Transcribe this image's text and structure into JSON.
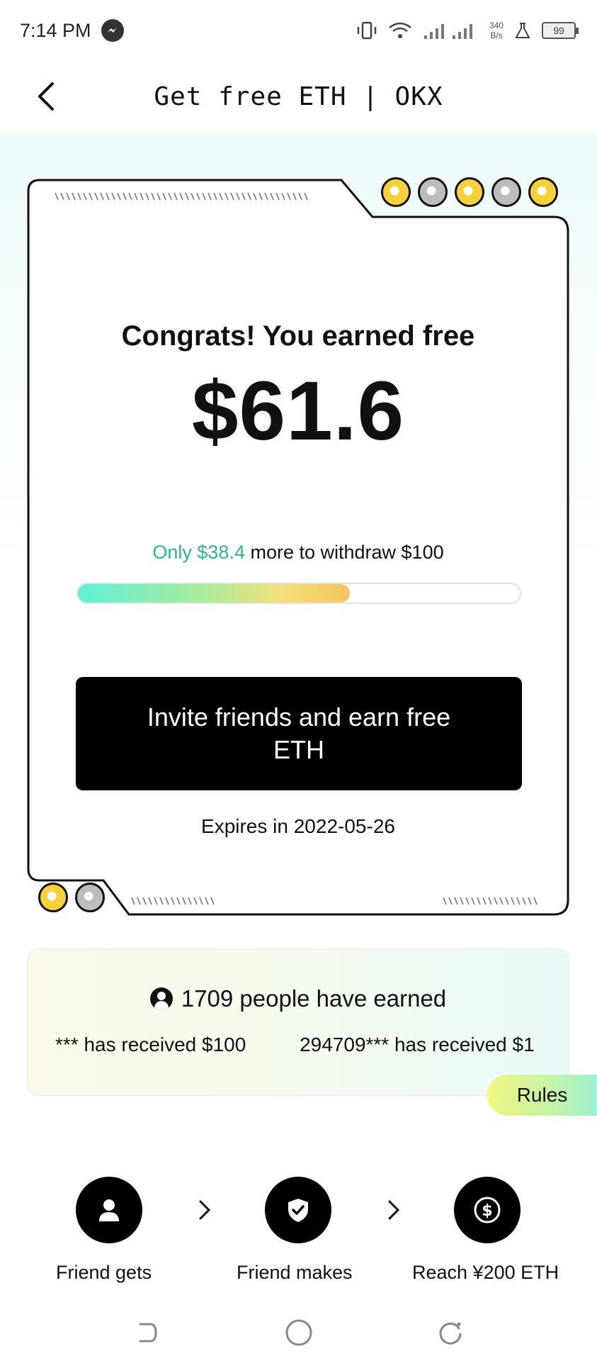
{
  "status_bar": {
    "time": "7:14 PM",
    "net_speed_value": "340",
    "net_speed_unit": "B/s",
    "battery": "99"
  },
  "header": {
    "title": "Get free ETH | OKX"
  },
  "card": {
    "congrats": "Congrats! You earned free",
    "amount": "$61.6",
    "progress_highlight": "Only $38.4",
    "progress_rest": " more to withdraw $100",
    "progress_fraction": 0.616,
    "invite_button": "Invite friends and earn free ETH",
    "expires": "Expires in 2022-05-26"
  },
  "earned": {
    "title": "1709 people have earned",
    "ticker": [
      "*** has received $100",
      "294709*** has received $1"
    ]
  },
  "rules_label": "Rules",
  "steps": [
    {
      "label": "Friend gets",
      "icon": "person-icon"
    },
    {
      "label": "Friend makes",
      "icon": "shield-check-icon"
    },
    {
      "label": "Reach ¥200 ETH",
      "icon": "dollar-icon"
    }
  ],
  "colors": {
    "accent_green": "#2bb58f",
    "button_bg": "#000000",
    "coin_gold": "#f5d23c"
  }
}
